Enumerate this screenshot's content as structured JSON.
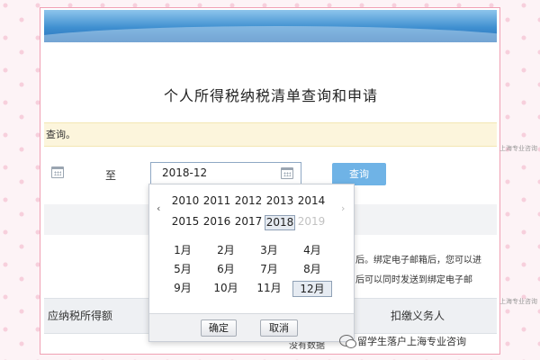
{
  "header": {
    "title": "个人所得税纳税清单查询和申请"
  },
  "notice": {
    "text": "查询。"
  },
  "date_range": {
    "to_label": "至",
    "end_value": "2018-12",
    "query_button": "查询"
  },
  "info": {
    "line1": "后。绑定电子邮箱后，您可以进",
    "line2": "后可以同时发送到绑定电子邮"
  },
  "table": {
    "col_income": "应纳税所得额",
    "col_withholder": "扣缴义务人"
  },
  "picker": {
    "prev_icon": "chevron-left",
    "next_icon": "chevron-right",
    "years_row1": [
      "2010",
      "2011",
      "2012",
      "2013",
      "2014"
    ],
    "years_row2": [
      "2015",
      "2016",
      "2017",
      "2018",
      "2019"
    ],
    "selected_year": "2018",
    "disabled_year": "2019",
    "months": [
      "1月",
      "2月",
      "3月",
      "4月",
      "5月",
      "6月",
      "7月",
      "8月",
      "9月",
      "10月",
      "11月",
      "12月"
    ],
    "selected_month": "12月",
    "confirm_label": "确定",
    "cancel_label": "取消"
  },
  "watermark": {
    "side1": "上海专业咨询",
    "side2": "上海专业咨询",
    "wechat_label": "留学生落户上海专业咨询",
    "partial_text": "没有数据"
  },
  "colors": {
    "accent_blue": "#6fb3e6",
    "notice_bg": "#fcf5dc",
    "frame_border": "#f0a0b4"
  }
}
